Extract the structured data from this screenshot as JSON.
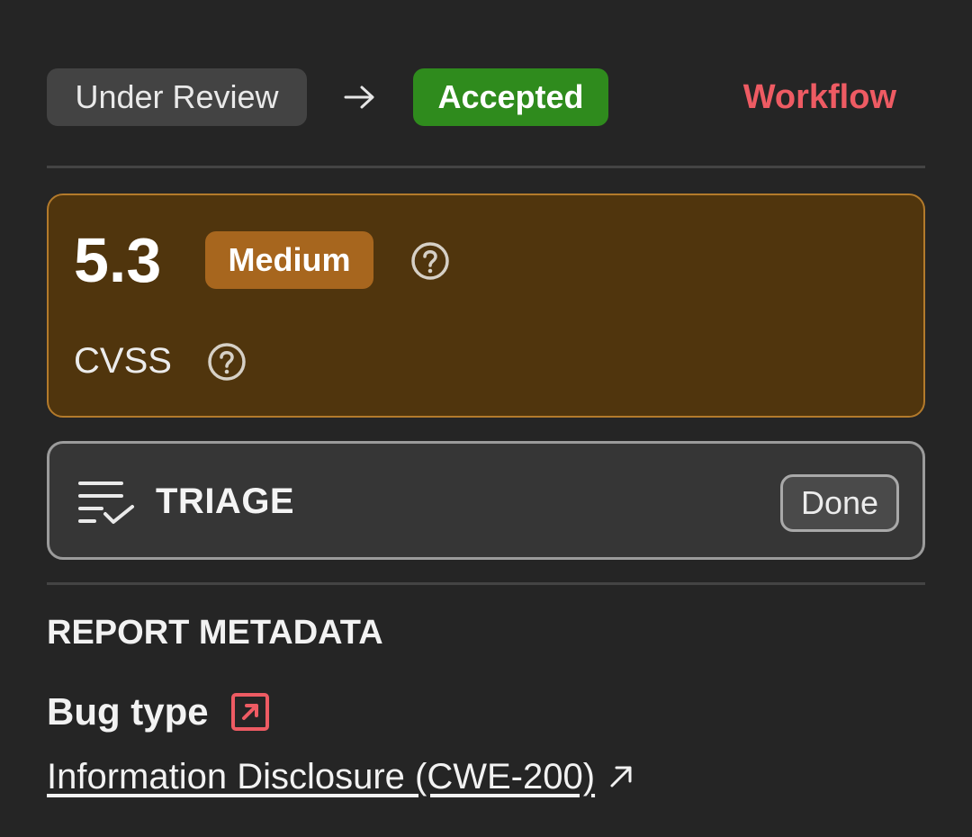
{
  "status": {
    "from": "Under Review",
    "arrow_icon": "arrow-right-icon",
    "to": "Accepted",
    "to_color": "#2f8b1d",
    "workflow_link": "Workflow",
    "link_color": "#ee5b63"
  },
  "severity": {
    "score": "5.3",
    "level": "Medium",
    "level_color": "#a7661e",
    "card_color": "#50350d",
    "metric_label": "CVSS",
    "help_icon": "question-circle-icon"
  },
  "triage": {
    "icon": "list-check-icon",
    "title": "TRIAGE",
    "status": "Done"
  },
  "metadata": {
    "heading": "REPORT METADATA",
    "bug_type_label": "Bug type",
    "bug_type_value": "Information Disclosure (CWE-200)",
    "external_icon": "external-link-icon"
  }
}
